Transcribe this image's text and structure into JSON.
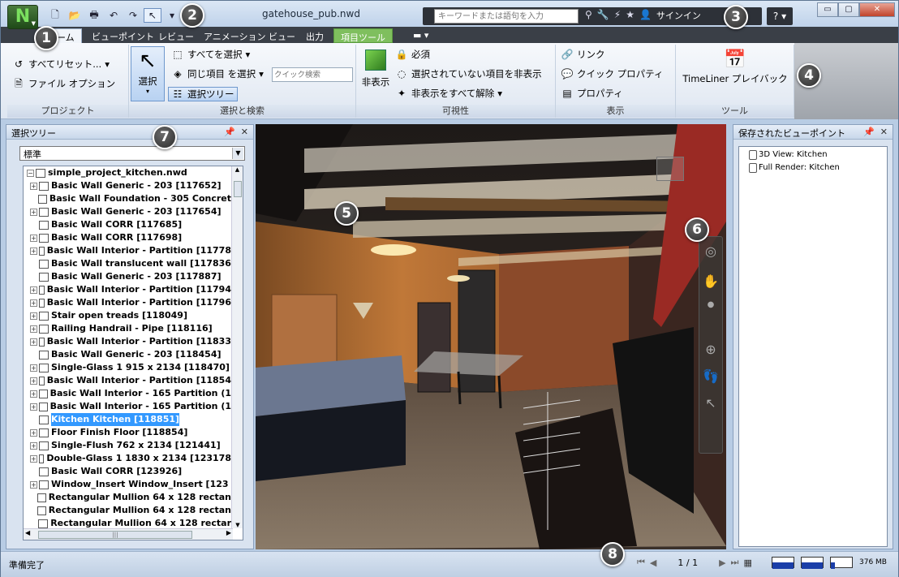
{
  "window": {
    "title": "gatehouse_pub.nwd",
    "app_logo": "N",
    "minimize": "▭",
    "restore": "▢",
    "close": "✕"
  },
  "infocenter": {
    "search_placeholder": "キーワードまたは語句を入力",
    "signin": "サインイン",
    "help": "?"
  },
  "tabs": [
    {
      "label": "ーム"
    },
    {
      "label": "ビューポイント"
    },
    {
      "label": "レビュー"
    },
    {
      "label": "アニメーション"
    },
    {
      "label": "ビュー"
    },
    {
      "label": "出力"
    },
    {
      "label": "項目ツール"
    }
  ],
  "ribbon": {
    "project": {
      "label": "プロジェクト",
      "reset_all": "すべてリセット...",
      "file_options": "ファイル オプション"
    },
    "select_search": {
      "label": "選択と検索",
      "select": "選択",
      "select_all": "すべてを選択",
      "select_same": "同じ項目 を選択",
      "quick_search_placeholder": "クイック検索",
      "selection_tree": "選択ツリー"
    },
    "visibility": {
      "label": "可視性",
      "hide": "非表示",
      "required": "必須",
      "hide_unselected": "選択されていない項目を非表示",
      "unhide_all": "非表示をすべて解除"
    },
    "display": {
      "label": "表示",
      "links": "リンク",
      "quick_props": "クイック プロパティ",
      "properties": "プロパティ"
    },
    "tools": {
      "label": "ツール",
      "timeliner": "TimeLiner プレイバック"
    }
  },
  "selection_tree": {
    "title": "選択ツリー",
    "mode": "標準",
    "root": "simple_project_kitchen.nwd",
    "items": [
      {
        "label": "Basic Wall Generic - 203 [117652]",
        "expandable": true
      },
      {
        "label": "Basic Wall Foundation - 305 Concret",
        "expandable": false
      },
      {
        "label": "Basic Wall Generic - 203 [117654]",
        "expandable": true
      },
      {
        "label": "Basic Wall CORR [117685]",
        "expandable": false
      },
      {
        "label": "Basic Wall CORR [117698]",
        "expandable": true
      },
      {
        "label": "Basic Wall Interior - Partition [11778",
        "expandable": true
      },
      {
        "label": "Basic Wall translucent wall [117836",
        "expandable": false
      },
      {
        "label": "Basic Wall Generic - 203 [117887]",
        "expandable": false
      },
      {
        "label": "Basic Wall Interior - Partition [11794",
        "expandable": true
      },
      {
        "label": "Basic Wall Interior - Partition [11796",
        "expandable": true
      },
      {
        "label": "Stair open treads [118049]",
        "expandable": true
      },
      {
        "label": "Railing Handrail - Pipe [118116]",
        "expandable": true
      },
      {
        "label": "Basic Wall Interior - Partition [11833",
        "expandable": true
      },
      {
        "label": "Basic Wall Generic - 203 [118454]",
        "expandable": false
      },
      {
        "label": "Single-Glass 1 915 x 2134 [118470]",
        "expandable": true
      },
      {
        "label": "Basic Wall Interior - Partition [11854",
        "expandable": true
      },
      {
        "label": "Basic Wall Interior - 165 Partition (1",
        "expandable": true
      },
      {
        "label": "Basic Wall Interior - 165 Partition (1",
        "expandable": true
      },
      {
        "label": "Kitchen Kitchen [118851]",
        "expandable": false,
        "selected": true
      },
      {
        "label": "Floor Finish Floor [118854]",
        "expandable": true
      },
      {
        "label": "Single-Flush 762 x 2134 [121441]",
        "expandable": true
      },
      {
        "label": "Double-Glass 1 1830 x 2134 [123178",
        "expandable": true
      },
      {
        "label": "Basic Wall CORR [123926]",
        "expandable": false
      },
      {
        "label": "Window_Insert Window_Insert [123",
        "expandable": true
      },
      {
        "label": "Rectangular Mullion 64 x 128 rectan",
        "expandable": false
      },
      {
        "label": "Rectangular Mullion 64 x 128 rectan",
        "expandable": false
      },
      {
        "label": "Rectangular Mullion 64 x 128 rectar",
        "expandable": false
      }
    ]
  },
  "saved_viewpoints": {
    "title": "保存されたビューポイント",
    "items": [
      "3D View: Kitchen",
      "Full Render: Kitchen"
    ]
  },
  "status": {
    "text": "準備完了",
    "page": "1 / 1",
    "memory": "376 MB"
  },
  "callouts": [
    "1",
    "2",
    "3",
    "4",
    "5",
    "6",
    "7",
    "8"
  ]
}
